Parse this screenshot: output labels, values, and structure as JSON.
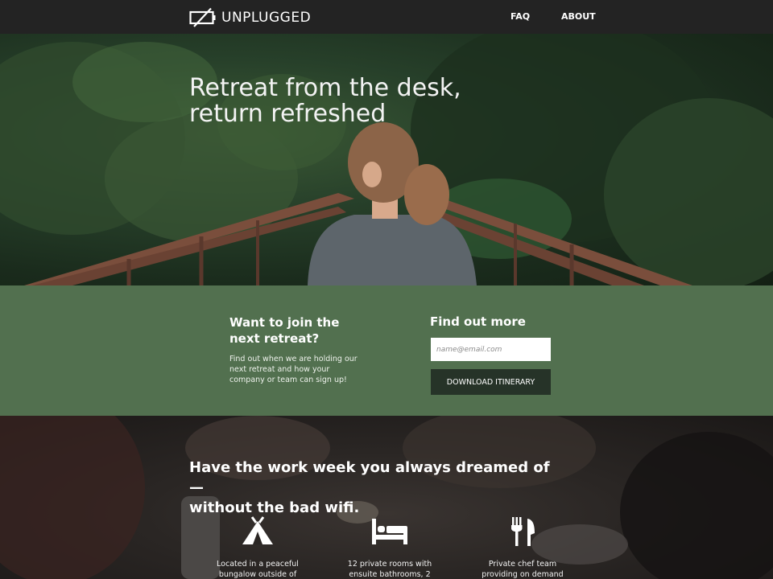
{
  "header": {
    "brand": "UNPLUGGED",
    "logo_icon": "unplugged-battery-icon",
    "nav": [
      {
        "label": "FAQ"
      },
      {
        "label": "ABOUT"
      }
    ]
  },
  "hero": {
    "title_line1": "Retreat from the desk,",
    "title_line2": "return refreshed"
  },
  "signup": {
    "heading_line1": "Want to join the",
    "heading_line2": "next retreat?",
    "description": "Find out when we are holding our next retreat and how your company or team can sign up!",
    "more_heading": "Find out more",
    "email_placeholder": "name@email.com",
    "button_label": "DOWNLOAD ITINERARY",
    "colors": {
      "band": "#52704f",
      "button": "#263328"
    }
  },
  "features": {
    "heading_line1": "Have the work week you always dreamed of —",
    "heading_line2": "without the bad wifi.",
    "items": [
      {
        "icon": "tent-icon",
        "text_line1": "Located in a peaceful",
        "text_line2": "bungalow outside of"
      },
      {
        "icon": "bed-icon",
        "text_line1": "12 private rooms with",
        "text_line2": "ensuite bathrooms, 2"
      },
      {
        "icon": "fork-knife-icon",
        "text_line1": "Private chef team",
        "text_line2": "providing on demand"
      }
    ]
  }
}
